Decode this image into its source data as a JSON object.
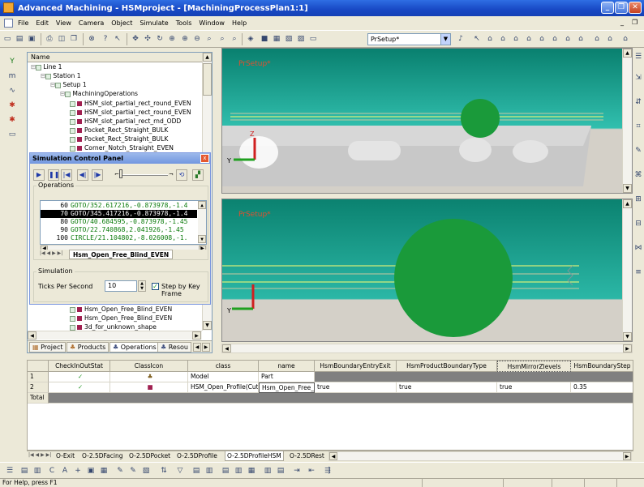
{
  "window": {
    "title": "Advanced Machining - HSMproject - [MachiningProcessPlan1:1]"
  },
  "menu": [
    "File",
    "Edit",
    "View",
    "Camera",
    "Object",
    "Simulate",
    "Tools",
    "Window",
    "Help"
  ],
  "toolbar": {
    "setup_combo": "PrSetup*"
  },
  "tree": {
    "header": "Name",
    "items": [
      {
        "label": "Line 1",
        "indent": 0
      },
      {
        "label": "Station 1",
        "indent": 1
      },
      {
        "label": "Setup 1",
        "indent": 2
      },
      {
        "label": "MachiningOperations",
        "indent": 3
      },
      {
        "label": "HSM_slot_partial_rect_round_EVEN",
        "indent": 4
      },
      {
        "label": "HSM_slot_partial_rect_round_EVEN",
        "indent": 4
      },
      {
        "label": "HSM_slot_partial_rect_rnd_ODD",
        "indent": 4
      },
      {
        "label": "Pocket_Rect_Straight_BULK",
        "indent": 4
      },
      {
        "label": "Pocket_Rect_Straight_BULK",
        "indent": 4
      },
      {
        "label": "Corner_Notch_Straight_EVEN",
        "indent": 4
      }
    ],
    "items_bottom": [
      {
        "label": "Hsm_Open_Free_Blind_EVEN"
      },
      {
        "label": "Hsm_Open_Free_Blind_EVEN"
      },
      {
        "label": "3d_for_unknown_shape"
      }
    ],
    "tabs": [
      "Project",
      "Products",
      "Operations",
      "Resou"
    ]
  },
  "sim_panel": {
    "title": "Simulation Control Panel",
    "close_glyph": "x",
    "operations_label": "Operations",
    "operations": [
      {
        "num": "60",
        "cmd": "GOTO/352.617216,-0.873978,-1.4"
      },
      {
        "num": "70",
        "cmd": "GOTO/345.417216,-0.873978,-1.4"
      },
      {
        "num": "80",
        "cmd": "GOTO/40.684595,-0.873978,-1.45"
      },
      {
        "num": "90",
        "cmd": "GOTO/22.740868,2.041926,-1.45"
      },
      {
        "num": "100",
        "cmd": "CIRCLE/21.104802,-8.026008,-1."
      }
    ],
    "selected_index": 1,
    "ops_tab": "Hsm_Open_Free_Blind_EVEN",
    "simulation_label": "Simulation",
    "ticks_label": "Ticks Per Second",
    "ticks_value": "10",
    "step_label": "Step by Key Frame",
    "step_checked": true
  },
  "viewports": [
    {
      "label": "PrSetup*"
    },
    {
      "label": "PrSetup*"
    }
  ],
  "axis": {
    "z": "Z",
    "y": "Y"
  },
  "grid": {
    "columns": [
      "CheckInOutStat",
      "ClassIcon",
      "class",
      "name",
      "HsmBoundaryEntryExit",
      "HsmProductBoundaryType",
      "HsmMirrorZlevels",
      "HsmBoundaryStep"
    ],
    "rows": [
      {
        "id": "1",
        "check": "✓",
        "class": "Model",
        "name": "Part",
        "entry": "",
        "ptype": "",
        "mirror": "",
        "step": ""
      },
      {
        "id": "2",
        "check": "✓",
        "class": "HSM_Open_Profile(Cutting",
        "name": "Hsm_Open_Free_",
        "entry": "true",
        "ptype": "true",
        "mirror": "true",
        "step": "0.35"
      },
      {
        "id": "Total",
        "check": "",
        "class": "",
        "name": "",
        "entry": "",
        "ptype": "",
        "mirror": "",
        "step": ""
      }
    ],
    "sheet_tabs": [
      "O-Exit",
      "O-2.5DFacing",
      "O-2.5DPocket",
      "O-2.5DProfile",
      "O-2.5DProfileHSM",
      "O-2.5DRest"
    ],
    "active_sheet": 4
  },
  "status": {
    "text": "For Help, press F1"
  }
}
